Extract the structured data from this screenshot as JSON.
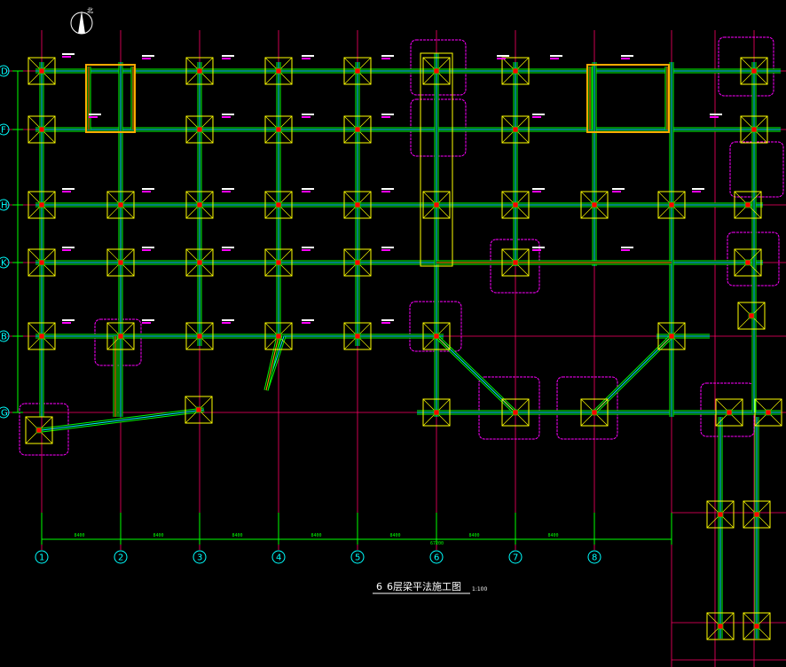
{
  "drawing": {
    "title": "6层梁平法施工图",
    "title_prefix": "6",
    "scale": "1:100",
    "north_label": "北"
  },
  "axes": {
    "columns": [
      "1",
      "2",
      "3",
      "4",
      "5",
      "6",
      "7",
      "8"
    ],
    "rows": [
      "D",
      "F",
      "H",
      "K",
      "B",
      "G"
    ]
  },
  "dimensions": {
    "bay_label": "8400",
    "overall_label": "67200"
  },
  "colors": {
    "background": "#000000",
    "axis_grid": "#ff0066",
    "axis_bubble": "#00ffff",
    "beam_outline": "#00ff00",
    "beam_core": "#00ffff",
    "column_hatch": "#ffff00",
    "column_core": "#ff0000",
    "cloud_revision": "#ff00ff",
    "dimension": "#00ff00",
    "text_note": "#ffffff",
    "special_beam": "#ffaa00"
  }
}
